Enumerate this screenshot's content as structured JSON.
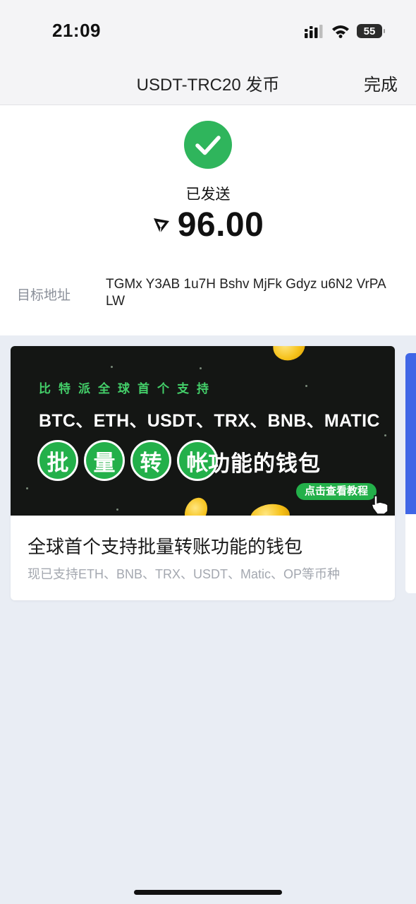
{
  "status_bar": {
    "time": "21:09",
    "battery": "55",
    "icons": [
      "cellular-signal-icon",
      "wifi-icon",
      "battery-icon"
    ]
  },
  "nav": {
    "title": "USDT-TRC20 发币",
    "done": "完成"
  },
  "result": {
    "status": "已发送",
    "token_icon": "tron-icon",
    "amount": "96.00",
    "address_label": "目标地址",
    "address": "TGMx Y3AB 1u7H Bshv MjFk Gdyz u6N2 VrPA LW"
  },
  "banner": {
    "kicker": "比特派全球首个支持",
    "headline": "BTC、ETH、USDT、TRX、BNB、MATIC",
    "highlight_chars": [
      "批",
      "量",
      "转",
      "帐"
    ],
    "subline": "功能的钱包",
    "cta": "点击查看教程",
    "card_title": "全球首个支持批量转账功能的钱包",
    "card_desc": "现已支持ETH、BNB、TRX、USDT、Matic、OP等币种"
  },
  "colors": {
    "success_green": "#2fb55c",
    "banner_green": "#23b04a",
    "page_bg": "#e9edf4",
    "peek_card_blue": "#3f66e6"
  }
}
